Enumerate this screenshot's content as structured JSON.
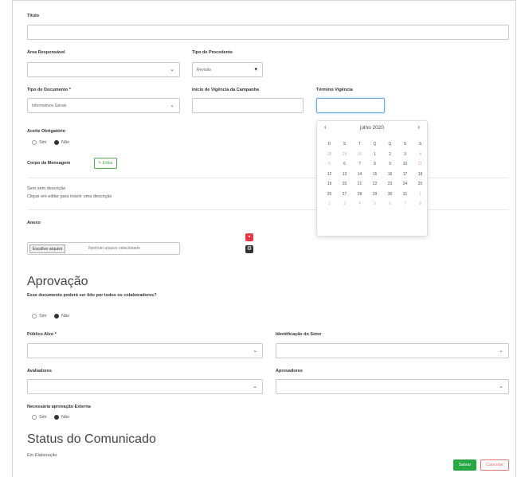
{
  "form": {
    "titulo_label": "Título",
    "titulo_value": "",
    "area_label": "Área Responsável",
    "area_value": "",
    "tipo_proc_label": "Tipo de Procedente",
    "tipo_proc_value": "Revisão",
    "tipo_doc_label": "Tipo de Documento *",
    "tipo_doc_value": "Informativos Gerais",
    "inicio_label": "Início de Vigência da Campanha",
    "inicio_value": "",
    "termino_label": "Término Vigência",
    "termino_value": "",
    "aceite_label": "Aceite Obrigatório",
    "sim": "Sim",
    "nao": "Não",
    "corpo_label": "Corpo da Mensagem",
    "corpo_btn": "Editar",
    "sem_descricao": "Sem sem descrição",
    "clique_editar": "Clique em editar para inserir uma descrição",
    "anexo_label": "Anexo",
    "escolher_arquivo": "Escolher arquivo",
    "nenhum_arquivo": "Nenhum arquivo selecionado",
    "aprovacao_heading": "Aprovação",
    "validado_question": "Esse documento poderá ser lido por todos os colaboradores?",
    "publico_label": "Público Alvo *",
    "identificacao_label": "Identificação do Setor",
    "avaliadores_label": "Avaliadores",
    "aprovadores_label": "Aprovadores",
    "externa_label": "Necessária aprovação Externa",
    "status_heading": "Status do Comunicado",
    "status_value": "Em Elaboração",
    "salvar": "Salvar",
    "cancelar": "Cancelar"
  },
  "calendar": {
    "title": "julho 2020",
    "prev": "‹",
    "next": "›",
    "weekdays": [
      "D",
      "S",
      "T",
      "Q",
      "Q",
      "S",
      "S"
    ],
    "weeks": [
      [
        "28",
        "29",
        "30",
        "1",
        "2",
        "3",
        "4"
      ],
      [
        "5",
        "6",
        "7",
        "8",
        "9",
        "10",
        "11"
      ],
      [
        "12",
        "13",
        "14",
        "15",
        "16",
        "17",
        "18"
      ],
      [
        "19",
        "20",
        "21",
        "22",
        "23",
        "24",
        "25"
      ],
      [
        "26",
        "27",
        "28",
        "29",
        "30",
        "31",
        "1"
      ],
      [
        "2",
        "3",
        "4",
        "5",
        "6",
        "7",
        "8"
      ]
    ]
  },
  "colors": {
    "primary": "#28a745",
    "danger": "#e53945",
    "focus": "#66afe9"
  }
}
